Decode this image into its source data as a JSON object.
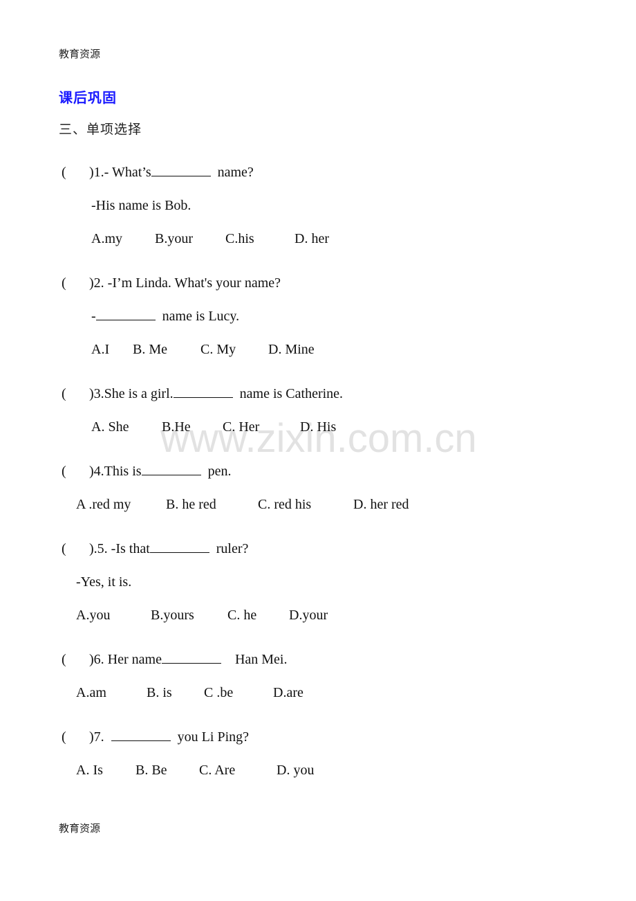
{
  "header": {
    "text": "教育资源"
  },
  "footer": {
    "text": "教育资源"
  },
  "title": "课后巩固",
  "section": "三、单项选择",
  "watermark": "www.zixin.com.cn",
  "questions": [
    {
      "bracket": "(",
      "number": ")1.- What’s",
      "after_blank": "name?",
      "response": "-His name is Bob.",
      "options": [
        "A.my",
        "B.your",
        "C.his",
        "D. her"
      ]
    },
    {
      "bracket": "(",
      "number": ")2. -I’m Linda. What's your name?",
      "response_before": "-",
      "response_after": "name is Lucy.",
      "options": [
        "A.I",
        "B. Me",
        "C. My",
        "D. Mine"
      ]
    },
    {
      "bracket": "(",
      "number": ")3.She is a girl.",
      "after_blank": "name is Catherine.",
      "options": [
        "A. She",
        "B.He",
        "C. Her",
        "D. His"
      ]
    },
    {
      "bracket": "(",
      "number": ")4.This is",
      "after_blank": "pen.",
      "options": [
        "A .red my",
        "B. he red",
        "C. red his",
        "D. her red"
      ]
    },
    {
      "bracket": "(",
      "number": ").5. -Is that",
      "after_blank": "ruler?",
      "response": "-Yes, it is.",
      "options": [
        "A.you",
        "B.yours",
        "C. he",
        "D.your"
      ]
    },
    {
      "bracket": "(",
      "number": ")6. Her name",
      "after_blank": "Han Mei.",
      "options": [
        "A.am",
        "B. is",
        "C .be",
        "D.are"
      ]
    },
    {
      "bracket": "(",
      "number": ")7.",
      "after_blank": "you Li Ping?",
      "options": [
        "A. Is",
        "B. Be",
        "C. Are",
        "D. you"
      ]
    }
  ]
}
